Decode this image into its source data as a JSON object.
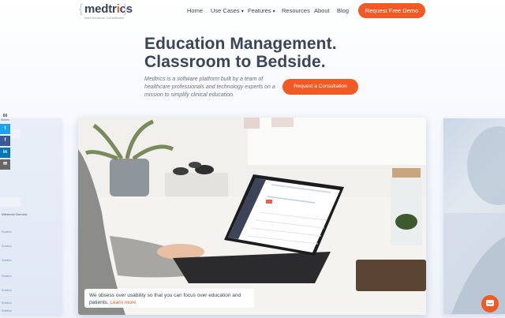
{
  "brand": {
    "name_pre": "medtr",
    "name_o": "i",
    "name_post": "cs",
    "tagline": "learn medicine, not software",
    "accent": "#f15a24"
  },
  "nav": {
    "items": [
      {
        "label": "Home",
        "dropdown": false
      },
      {
        "label": "Use Cases",
        "dropdown": true
      },
      {
        "label": "Features",
        "dropdown": true
      },
      {
        "label": "Resources",
        "dropdown": false
      },
      {
        "label": "About",
        "dropdown": false
      },
      {
        "label": "Blog",
        "dropdown": false
      }
    ],
    "cta": "Request Free Demo"
  },
  "hero": {
    "title_line1": "Education Management.",
    "title_line2": "Classroom to Bedside.",
    "subtitle": "Medtrics is a software platform built by a team of healthcare professionals and technology experts on a mission to simplify clinical education.",
    "cta": "Request a Consultation"
  },
  "share": {
    "count": "60",
    "label": "Shares"
  },
  "caption": {
    "text": "We obsess over usability so that you can focus over education and patients.",
    "link": "Learn more"
  },
  "side_left": {
    "rows": [
      "Rotation",
      "Rotation",
      "Rotation",
      "Rotation",
      "Rotation",
      "Rotation",
      "Rotation"
    ],
    "header": "Milestones Overview"
  }
}
